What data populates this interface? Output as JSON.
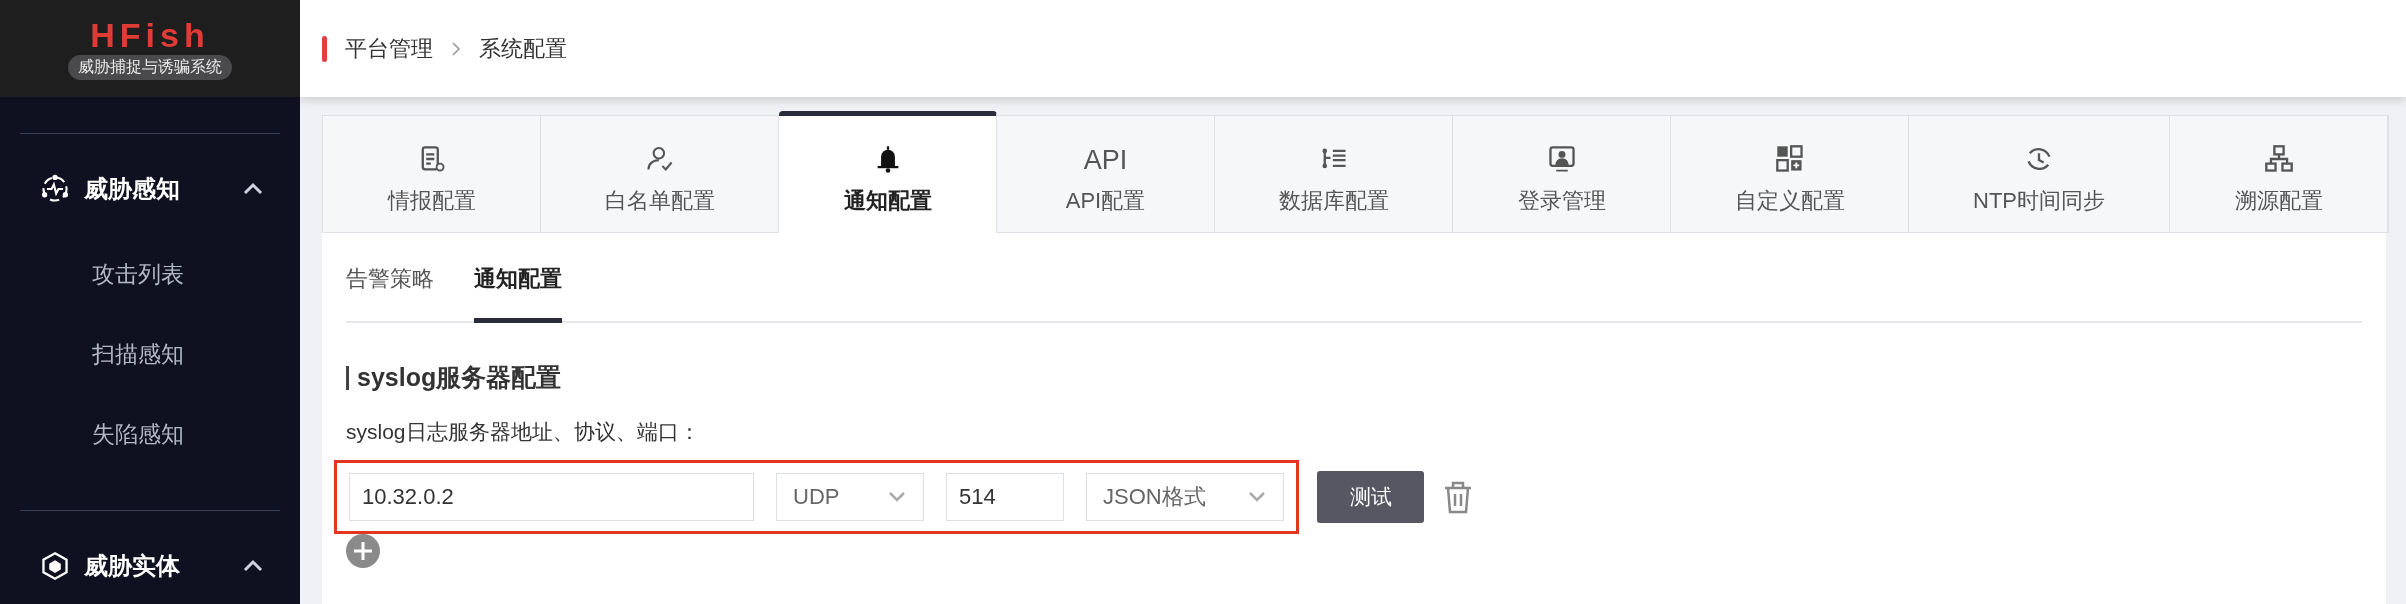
{
  "sidebar": {
    "logo": "HFish",
    "subtitle": "威胁捕捉与诱骗系统",
    "groups": [
      {
        "label": "威胁感知",
        "kind": "pulse",
        "expanded": true,
        "items": [
          {
            "label": "攻击列表"
          },
          {
            "label": "扫描感知"
          },
          {
            "label": "失陷感知"
          }
        ]
      },
      {
        "label": "威胁实体",
        "kind": "cube",
        "expanded": true
      }
    ]
  },
  "breadcrumb": [
    "平台管理",
    "系统配置"
  ],
  "tabs": [
    {
      "label": "情报配置",
      "kind": "document",
      "selected": false
    },
    {
      "label": "白名单配置",
      "kind": "user",
      "selected": false
    },
    {
      "label": "通知配置",
      "kind": "bell",
      "selected": true
    },
    {
      "label": "API配置",
      "kind": "text",
      "icon_text": "API",
      "selected": false
    },
    {
      "label": "数据库配置",
      "kind": "list",
      "selected": false
    },
    {
      "label": "登录管理",
      "kind": "monitor",
      "selected": false
    },
    {
      "label": "自定义配置",
      "kind": "grid",
      "selected": false
    },
    {
      "label": "NTP时间同步",
      "kind": "clock",
      "selected": false
    },
    {
      "label": "溯源配置",
      "kind": "network",
      "selected": false
    }
  ],
  "subtabs": [
    {
      "label": "告警策略",
      "selected": false
    },
    {
      "label": "通知配置",
      "selected": true
    }
  ],
  "section_title": "syslog服务器配置",
  "field_label": "syslog日志服务器地址、协议、端口：",
  "rows": [
    {
      "address": "10.32.0.2",
      "protocol": "UDP",
      "port": "514",
      "format": "JSON格式",
      "test_button": "测试",
      "highlighted": true
    }
  ]
}
